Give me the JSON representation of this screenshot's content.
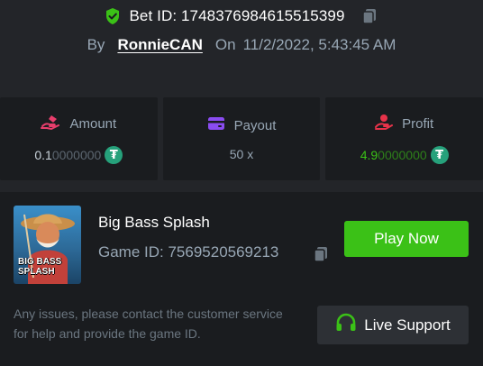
{
  "header": {
    "bet_id_label": "Bet ID: 1748376984615515399",
    "by_label": "By",
    "username": "RonnieCAN",
    "on_label": "On",
    "timestamp": "11/2/2022, 5:43:45 AM"
  },
  "stats": {
    "amount": {
      "label": "Amount",
      "value_strong": "0.1",
      "value_faint": "0000000",
      "currency_icon": "tether-icon"
    },
    "payout": {
      "label": "Payout",
      "value": "50 x"
    },
    "profit": {
      "label": "Profit",
      "value_strong": "4.9",
      "value_faint": "0000000",
      "currency_icon": "tether-icon"
    }
  },
  "game": {
    "thumbnail_title_line1": "BIG BASS",
    "thumbnail_title_line2": "SPLASH",
    "name": "Big Bass Splash",
    "game_id_label": "Game ID: 7569520569213",
    "play_label": "Play Now"
  },
  "support": {
    "issue_text": "Any issues, please contact the customer service for help and provide the game ID.",
    "button_label": "Live Support"
  },
  "colors": {
    "background": "#232529",
    "card": "#1a1c1f",
    "accent_green": "#3bc117",
    "muted_text": "#98a7b5",
    "tether": "#26a17b",
    "amount_icon": "#e83e6c",
    "payout_icon": "#8a4cf0",
    "profit_icon": "#e8334a"
  }
}
